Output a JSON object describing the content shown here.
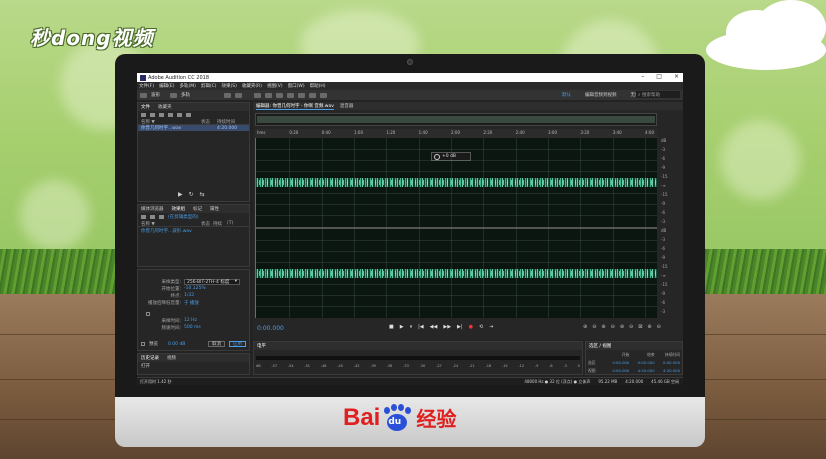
{
  "brand": {
    "text": "秒dong视频"
  },
  "baidu": {
    "bai": "Bai",
    "du": "du",
    "jingyan": "经验"
  },
  "window": {
    "title": "Adobe Audition CC 2018",
    "controls": [
      "–",
      "□",
      "×"
    ]
  },
  "menu": [
    "文件(F)",
    "编辑(E)",
    "多轨(M)",
    "剪辑(C)",
    "效果(S)",
    "收藏夹(R)",
    "视图(V)",
    "窗口(W)",
    "帮助(H)"
  ],
  "toolbar": {
    "waveform_label": "波形",
    "multitrack_label": "多轨",
    "workspaces": [
      "默认",
      "编辑音频到视频",
      "无线电作品"
    ],
    "active_workspace": "默认",
    "search_placeholder": "搜索帮助"
  },
  "files_panel": {
    "tabs": [
      "文件",
      "收藏夹"
    ],
    "columns": [
      "名称 ▼",
      "状态",
      "持续时间"
    ],
    "file": {
      "name": "你曾几何时字...wav",
      "duration": "4:20.000"
    },
    "mini_transport": [
      "▶",
      "↻",
      "⇆"
    ]
  },
  "effects_panel": {
    "tabs": [
      "媒体浏览器",
      "效果组",
      "标记",
      "属性"
    ],
    "preset_link": "(在剪辑类型的)",
    "columns": [
      "名称 ▼",
      "状态",
      "持续",
      "(T)"
    ],
    "item": "你曾几何时字...波形.wav"
  },
  "props_panel": {
    "sample_type_label": "采样类型:",
    "sample_type_value": "256-BIT-2TH-4 标度",
    "start_label": "开始位置:",
    "start_value": "-10.125%",
    "length_label": "终点:",
    "length_value": "1/32",
    "dither_label": "播放后降低音量:",
    "dither_value": "于 播放",
    "rate_label": "采样时间:",
    "rate_value": "12 Hz",
    "pitch_label": "频速时间:",
    "pitch_value": "500 ms",
    "footer": {
      "checkbox_label": "预览",
      "input_value": "0.00 dB",
      "cancel": "取消",
      "apply": "应用"
    }
  },
  "history_panel": {
    "tabs": [
      "历史记录",
      "视频"
    ],
    "item": "打开",
    "footer": "打开用时 1.42 秒"
  },
  "editor": {
    "tabs": [
      "编辑器: 你曾几何时字 - 你啊 音频.wav",
      "混音器"
    ],
    "ruler_ticks": [
      "hms",
      "0:20",
      "0:40",
      "1:00",
      "1:20",
      "1:40",
      "2:00",
      "2:20",
      "2:40",
      "3:00",
      "3:20",
      "3:40",
      "4:00"
    ],
    "hud_value": "+0 dB",
    "db_scale": [
      "dB",
      "-3",
      "-6",
      "-9",
      "-15",
      "-∞",
      "-15",
      "-9",
      "-6",
      "-3",
      "dB",
      "-3",
      "-6",
      "-9",
      "-15",
      "-∞",
      "-15",
      "-9",
      "-6",
      "-3"
    ],
    "current_time": "0:00.000",
    "transport": [
      "■",
      "▶",
      "⏸",
      "|◀",
      "◀◀",
      "▶▶",
      "▶|",
      "●",
      "⟲",
      "⇥"
    ],
    "zoom_icons": [
      "⊕",
      "⊖",
      "⊕",
      "⊖",
      "⊕",
      "⊖",
      "⊠",
      "⊕",
      "⊖"
    ]
  },
  "levels_panel": {
    "title": "电平",
    "scale": [
      "dB",
      "-57",
      "-54",
      "-51",
      "-48",
      "-45",
      "-42",
      "-39",
      "-36",
      "-33",
      "-30",
      "-27",
      "-24",
      "-21",
      "-18",
      "-15",
      "-12",
      "-9",
      "-6",
      "-3",
      "0"
    ]
  },
  "selection_panel": {
    "title": "选区 / 视图",
    "headers": [
      "开始",
      "结束",
      "持续时间"
    ],
    "rows": [
      {
        "label": "选区",
        "start": "0:00.000",
        "end": "0:00.000",
        "duration": "0:00.000"
      },
      {
        "label": "视图",
        "start": "0:00.000",
        "end": "4:20.000",
        "duration": "4:20.000"
      }
    ]
  },
  "statusbar": {
    "left": "打开用时 1.42 秒",
    "items": [
      "48000 Hz ● 32 位 (浮点) ● 立体声",
      "95.22 MB",
      "4:20.000",
      "45.46 GB 空闲"
    ]
  }
}
